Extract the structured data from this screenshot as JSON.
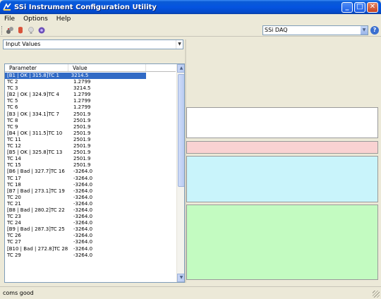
{
  "window": {
    "title": "SSi Instrument Configuration Utility",
    "minimize": "_",
    "maximize": "□",
    "close": "✕"
  },
  "menu": {
    "file": "File",
    "options": "Options",
    "help": "Help"
  },
  "toolbar": {
    "icons": [
      "connect-icon",
      "stop-icon",
      "bulb-icon",
      "settings-icon"
    ],
    "instrument_selected": "SSi DAQ",
    "help_icon": "?"
  },
  "left": {
    "view_selected": "Input Values",
    "columns": [
      "Parameter",
      "Value"
    ],
    "rows": [
      {
        "parameter": "[B1 | OK | 315.8]TC 1",
        "value": "3214.5",
        "selected": true
      },
      {
        "parameter": "TC 2",
        "value": "1.2799"
      },
      {
        "parameter": "TC 3",
        "value": "3214.5"
      },
      {
        "parameter": "[B2 | OK | 324.9]TC 4",
        "value": "1.2799"
      },
      {
        "parameter": "TC 5",
        "value": "1.2799"
      },
      {
        "parameter": "TC 6",
        "value": "1.2799"
      },
      {
        "parameter": "[B3 | OK | 334.1]TC 7",
        "value": "2501.9"
      },
      {
        "parameter": "TC 8",
        "value": "2501.9"
      },
      {
        "parameter": "TC 9",
        "value": "2501.9"
      },
      {
        "parameter": "[B4 | OK | 311.5]TC 10",
        "value": "2501.9"
      },
      {
        "parameter": "TC 11",
        "value": "2501.9"
      },
      {
        "parameter": "TC 12",
        "value": "2501.9"
      },
      {
        "parameter": "[B5 | OK | 325.8]TC 13",
        "value": "2501.9"
      },
      {
        "parameter": "TC 14",
        "value": "2501.9"
      },
      {
        "parameter": "TC 15",
        "value": "2501.9"
      },
      {
        "parameter": "[B6 | Bad | 327.7]TC 16",
        "value": "-3264.0"
      },
      {
        "parameter": "TC 17",
        "value": "-3264.0"
      },
      {
        "parameter": "TC 18",
        "value": "-3264.0"
      },
      {
        "parameter": "[B7 | Bad | 273.1]TC 19",
        "value": "-3264.0"
      },
      {
        "parameter": "TC 20",
        "value": "-3264.0"
      },
      {
        "parameter": "TC 21",
        "value": "-3264.0"
      },
      {
        "parameter": "[B8 | Bad | 280.2]TC 22",
        "value": "-3264.0"
      },
      {
        "parameter": "TC 23",
        "value": "-3264.0"
      },
      {
        "parameter": "TC 24",
        "value": "-3264.0"
      },
      {
        "parameter": "[B9 | Bad | 287.3]TC 25",
        "value": "-3264.0"
      },
      {
        "parameter": "TC 26",
        "value": "-3264.0"
      },
      {
        "parameter": "TC 27",
        "value": "-3264.0"
      },
      {
        "parameter": "[B10 | Bad | 272.8]TC 28",
        "value": "-3264.0"
      },
      {
        "parameter": "TC 29",
        "value": "-3264.0"
      }
    ]
  },
  "right": {
    "boxes": [
      {
        "name": "white-panel",
        "color": "#ffffff"
      },
      {
        "name": "pink-panel",
        "color": "#f9d2d2"
      },
      {
        "name": "cyan-panel",
        "color": "#c9f4fb"
      },
      {
        "name": "green-panel",
        "color": "#c3fbc1"
      }
    ]
  },
  "status": {
    "text": "coms good"
  },
  "colors": {
    "titlebar": "#0554e0",
    "selection": "#316ac5",
    "face": "#ece9d8"
  }
}
